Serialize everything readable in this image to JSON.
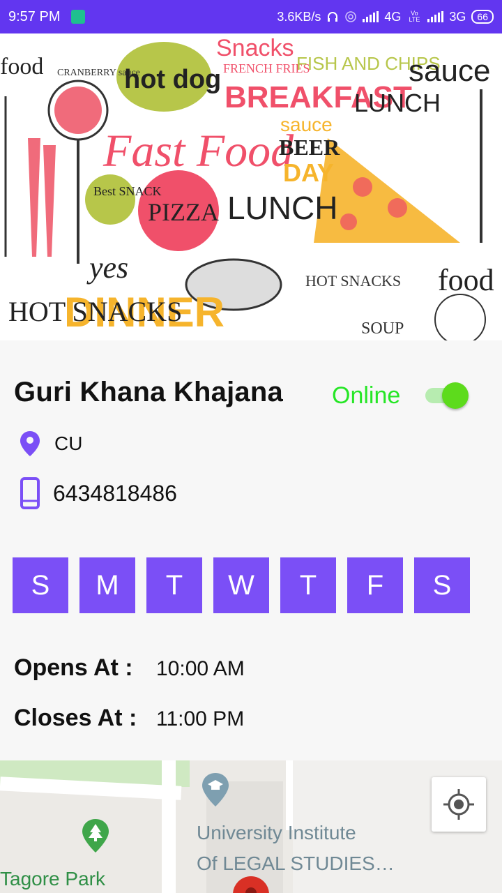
{
  "status_bar": {
    "time": "9:57 PM",
    "net_speed": "3.6KB/s",
    "network_1": "4G",
    "volte": "Vo LTE",
    "network_2": "3G",
    "battery": "66"
  },
  "banner": {
    "words": [
      "food",
      "CRANBERRY sauce",
      "hot dog",
      "Snacks",
      "FRENCH FRIES",
      "FISH AND CHIPS",
      "sauce",
      "BREAKFAST",
      "LUNCH",
      "Fast Food",
      "sauce",
      "BEER",
      "DAY",
      "Best SNACK",
      "PIZZA",
      "LUNCH",
      "yes",
      "HOT SNACKS",
      "DINNER",
      "HOT SNACKS",
      "food",
      "SOUP"
    ]
  },
  "restaurant": {
    "name": "Guri Khana Khajana",
    "status_label": "Online",
    "online": true,
    "location": "CU",
    "phone": "6434818486"
  },
  "days": [
    "S",
    "M",
    "T",
    "W",
    "T",
    "F",
    "S"
  ],
  "hours": {
    "opens_label": "Opens At :",
    "opens_value": "10:00 AM",
    "closes_label": "Closes At :",
    "closes_value": "11:00 PM"
  },
  "map": {
    "place_1": "University Institute",
    "place_1_line2": "Of LEGAL STUDIES…",
    "place_2": "Tagore Park"
  },
  "colors": {
    "status_bar": "#6236f0",
    "accent": "#7b4ff6",
    "online": "#26e626",
    "toggle_thumb": "#5ddb1c"
  },
  "icons": [
    "android-icon",
    "headset-icon",
    "hotspot-icon",
    "signal-icon",
    "location-pin-icon",
    "phone-icon",
    "my-location-icon",
    "graduation-cap-icon",
    "tree-icon",
    "map-pin-icon"
  ]
}
